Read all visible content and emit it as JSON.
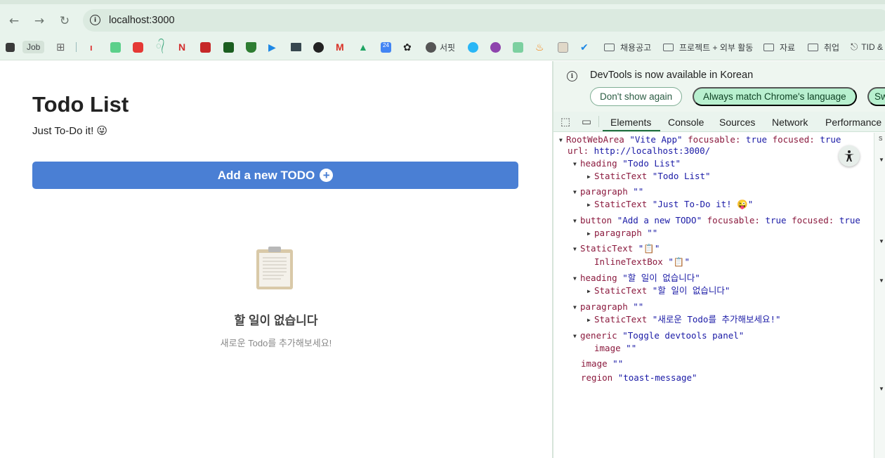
{
  "browser": {
    "url": "localhost:3000",
    "bookmarks": [
      {
        "label": "Job"
      },
      {
        "label": "서핏"
      },
      {
        "label": "채용공고"
      },
      {
        "label": "프로젝트 + 외부 활동"
      },
      {
        "label": "자료"
      },
      {
        "label": "취업"
      },
      {
        "label": "TID &"
      }
    ]
  },
  "page": {
    "title": "Todo List",
    "subtitle": "Just To-Do it! 😜",
    "add_button": "Add a new TODO",
    "empty_title": "할 일이 없습니다",
    "empty_subtitle": "새로운 Todo를 추가해보세요!"
  },
  "devtools": {
    "info_message": "DevTools is now available in Korean",
    "dont_show": "Don't show again",
    "match_language": "Always match Chrome's language",
    "third_pill": "Sw",
    "tabs": [
      "Elements",
      "Console",
      "Sources",
      "Network",
      "Performance"
    ],
    "active_tab": "Elements",
    "tree": {
      "root_role": "RootWebArea",
      "root_name": "\"Vite App\"",
      "focusable_attr": "focusable:",
      "true_val": "true",
      "focused_attr": "focused:",
      "url_attr": "url:",
      "url_val": "http://localhost:3000/",
      "heading_role": "heading",
      "heading_name": "\"Todo List\"",
      "static_role": "StaticText",
      "static_todo_name": "\"Todo List\"",
      "paragraph_role": "paragraph",
      "empty_name": "\"\"",
      "static_just_name": "\"Just To-Do it! 😜\"",
      "button_role": "button",
      "button_name": "\"Add a new TODO\"",
      "static_clip_name": "\"📋\"",
      "inline_role": "InlineTextBox",
      "inline_name": "\"📋\"",
      "heading2_name": "\"할 일이 없습니다\"",
      "static_empty_name": "\"할 일이 없습니다\"",
      "static_new_name": "\"새로운 Todo를 추가해보세요!\"",
      "generic_role": "generic",
      "generic_name": "\"Toggle devtools panel\"",
      "image_role": "image",
      "region_role": "region",
      "region_name": "\"toast-message\""
    }
  },
  "colors": {
    "chrome_bg": "#e8f3ec",
    "add_button": "#4a7fd4",
    "devtools_active": "#1e6e3e"
  }
}
